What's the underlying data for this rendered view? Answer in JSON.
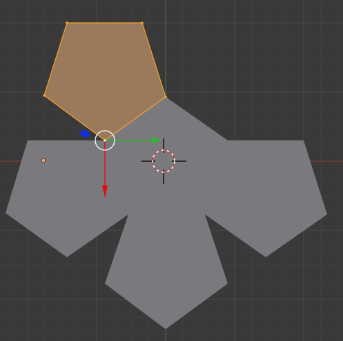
{
  "viewport": {
    "background_color": "#393939",
    "grid_minor_color": "#404040",
    "grid_major_color": "#4a4a4a",
    "axis_x_color": "#8a3a3a",
    "axis_y_color": "#3f7a3f"
  },
  "mesh": {
    "face_color": "#7a7a7e",
    "selected_face_color": "#9b7a5c",
    "selected_edge_color": "#f0a030",
    "selected_vertex_color": "#f0a030",
    "origin_color": "#f0a070"
  },
  "transform_gizmo": {
    "x_axis_color": "#e01010",
    "y_axis_color": "#20c020",
    "z_axis_color": "#1030e0",
    "center_ring_color": "#ffffff"
  },
  "cursor_3d": {
    "ring_primary": "#ffffff",
    "ring_secondary": "#e03030",
    "crosshair_color": "#000000"
  },
  "icons": [
    "3d-cursor-icon",
    "object-origin-icon",
    "transform-gizmo-icon"
  ]
}
